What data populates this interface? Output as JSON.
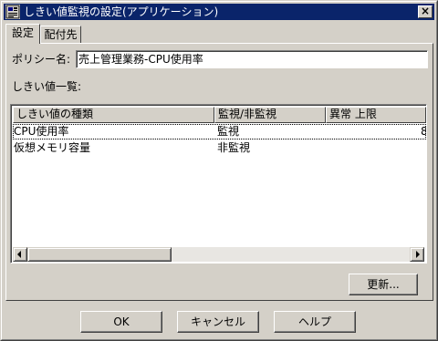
{
  "window": {
    "title": "しきい値監視の設定(アプリケーション)",
    "close_symbol": "×"
  },
  "tabs": [
    {
      "label": "設定",
      "active": true
    },
    {
      "label": "配付先",
      "active": false
    }
  ],
  "policy": {
    "label": "ポリシー名:",
    "value": "売上管理業務-CPU使用率"
  },
  "threshold_list": {
    "label": "しきい値一覧:",
    "columns": [
      "しきい値の種類",
      "監視/非監視",
      "異常 上限"
    ],
    "rows": [
      {
        "type": "CPU使用率",
        "monitor": "監視",
        "upper": "8"
      },
      {
        "type": "仮想メモリ容量",
        "monitor": "非監視",
        "upper": ""
      }
    ],
    "selected_row": 0
  },
  "buttons": {
    "update": "更新...",
    "ok": "OK",
    "cancel": "キャンセル",
    "help": "ヘルプ"
  },
  "colors": {
    "titlebar": "#0a246a",
    "face": "#d4d0c8"
  }
}
